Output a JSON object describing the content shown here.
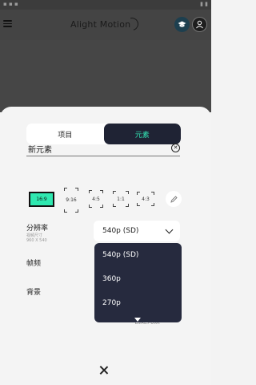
{
  "app": {
    "title": "Alight Motion"
  },
  "tabs": [
    {
      "label": "项目",
      "active": false
    },
    {
      "label": "元素",
      "active": true
    }
  ],
  "name_field": {
    "value": "新元素"
  },
  "aspect_ratios": [
    {
      "label": "16:9",
      "selected": true
    },
    {
      "label": "9:16"
    },
    {
      "label": "4:5"
    },
    {
      "label": "1:1"
    },
    {
      "label": "4:3"
    }
  ],
  "resolution": {
    "label": "分辨率",
    "sub_label": "视频尺寸",
    "dimensions": "960 X 540",
    "selected": "540p (SD)",
    "options": [
      "540p (SD)",
      "360p",
      "270p"
    ]
  },
  "frame_rate": {
    "label": "帧频"
  },
  "background": {
    "label": "背景"
  },
  "create_hint": "创建元素",
  "colors": {
    "accent": "#2fe8b0",
    "dark": "#1f2334"
  }
}
